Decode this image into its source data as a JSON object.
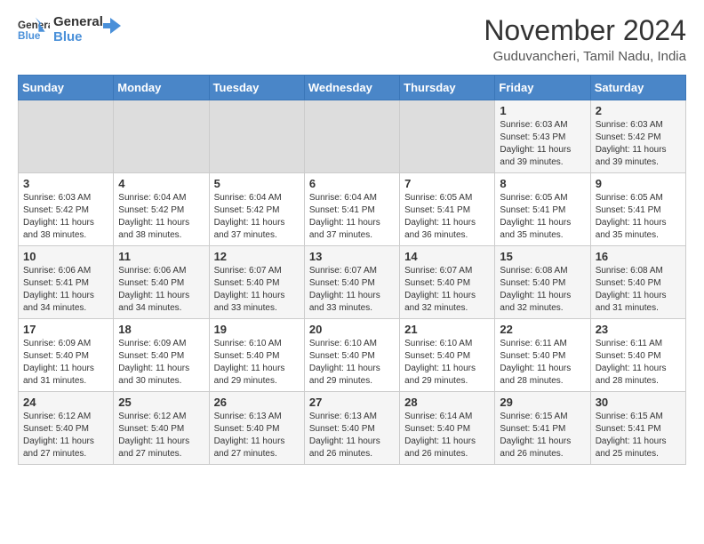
{
  "header": {
    "logo_line1": "General",
    "logo_line2": "Blue",
    "month": "November 2024",
    "location": "Guduvancheri, Tamil Nadu, India"
  },
  "weekdays": [
    "Sunday",
    "Monday",
    "Tuesday",
    "Wednesday",
    "Thursday",
    "Friday",
    "Saturday"
  ],
  "weeks": [
    [
      {
        "day": "",
        "info": ""
      },
      {
        "day": "",
        "info": ""
      },
      {
        "day": "",
        "info": ""
      },
      {
        "day": "",
        "info": ""
      },
      {
        "day": "",
        "info": ""
      },
      {
        "day": "1",
        "info": "Sunrise: 6:03 AM\nSunset: 5:43 PM\nDaylight: 11 hours and 39 minutes."
      },
      {
        "day": "2",
        "info": "Sunrise: 6:03 AM\nSunset: 5:42 PM\nDaylight: 11 hours and 39 minutes."
      }
    ],
    [
      {
        "day": "3",
        "info": "Sunrise: 6:03 AM\nSunset: 5:42 PM\nDaylight: 11 hours and 38 minutes."
      },
      {
        "day": "4",
        "info": "Sunrise: 6:04 AM\nSunset: 5:42 PM\nDaylight: 11 hours and 38 minutes."
      },
      {
        "day": "5",
        "info": "Sunrise: 6:04 AM\nSunset: 5:42 PM\nDaylight: 11 hours and 37 minutes."
      },
      {
        "day": "6",
        "info": "Sunrise: 6:04 AM\nSunset: 5:41 PM\nDaylight: 11 hours and 37 minutes."
      },
      {
        "day": "7",
        "info": "Sunrise: 6:05 AM\nSunset: 5:41 PM\nDaylight: 11 hours and 36 minutes."
      },
      {
        "day": "8",
        "info": "Sunrise: 6:05 AM\nSunset: 5:41 PM\nDaylight: 11 hours and 35 minutes."
      },
      {
        "day": "9",
        "info": "Sunrise: 6:05 AM\nSunset: 5:41 PM\nDaylight: 11 hours and 35 minutes."
      }
    ],
    [
      {
        "day": "10",
        "info": "Sunrise: 6:06 AM\nSunset: 5:41 PM\nDaylight: 11 hours and 34 minutes."
      },
      {
        "day": "11",
        "info": "Sunrise: 6:06 AM\nSunset: 5:40 PM\nDaylight: 11 hours and 34 minutes."
      },
      {
        "day": "12",
        "info": "Sunrise: 6:07 AM\nSunset: 5:40 PM\nDaylight: 11 hours and 33 minutes."
      },
      {
        "day": "13",
        "info": "Sunrise: 6:07 AM\nSunset: 5:40 PM\nDaylight: 11 hours and 33 minutes."
      },
      {
        "day": "14",
        "info": "Sunrise: 6:07 AM\nSunset: 5:40 PM\nDaylight: 11 hours and 32 minutes."
      },
      {
        "day": "15",
        "info": "Sunrise: 6:08 AM\nSunset: 5:40 PM\nDaylight: 11 hours and 32 minutes."
      },
      {
        "day": "16",
        "info": "Sunrise: 6:08 AM\nSunset: 5:40 PM\nDaylight: 11 hours and 31 minutes."
      }
    ],
    [
      {
        "day": "17",
        "info": "Sunrise: 6:09 AM\nSunset: 5:40 PM\nDaylight: 11 hours and 31 minutes."
      },
      {
        "day": "18",
        "info": "Sunrise: 6:09 AM\nSunset: 5:40 PM\nDaylight: 11 hours and 30 minutes."
      },
      {
        "day": "19",
        "info": "Sunrise: 6:10 AM\nSunset: 5:40 PM\nDaylight: 11 hours and 29 minutes."
      },
      {
        "day": "20",
        "info": "Sunrise: 6:10 AM\nSunset: 5:40 PM\nDaylight: 11 hours and 29 minutes."
      },
      {
        "day": "21",
        "info": "Sunrise: 6:10 AM\nSunset: 5:40 PM\nDaylight: 11 hours and 29 minutes."
      },
      {
        "day": "22",
        "info": "Sunrise: 6:11 AM\nSunset: 5:40 PM\nDaylight: 11 hours and 28 minutes."
      },
      {
        "day": "23",
        "info": "Sunrise: 6:11 AM\nSunset: 5:40 PM\nDaylight: 11 hours and 28 minutes."
      }
    ],
    [
      {
        "day": "24",
        "info": "Sunrise: 6:12 AM\nSunset: 5:40 PM\nDaylight: 11 hours and 27 minutes."
      },
      {
        "day": "25",
        "info": "Sunrise: 6:12 AM\nSunset: 5:40 PM\nDaylight: 11 hours and 27 minutes."
      },
      {
        "day": "26",
        "info": "Sunrise: 6:13 AM\nSunset: 5:40 PM\nDaylight: 11 hours and 27 minutes."
      },
      {
        "day": "27",
        "info": "Sunrise: 6:13 AM\nSunset: 5:40 PM\nDaylight: 11 hours and 26 minutes."
      },
      {
        "day": "28",
        "info": "Sunrise: 6:14 AM\nSunset: 5:40 PM\nDaylight: 11 hours and 26 minutes."
      },
      {
        "day": "29",
        "info": "Sunrise: 6:15 AM\nSunset: 5:41 PM\nDaylight: 11 hours and 26 minutes."
      },
      {
        "day": "30",
        "info": "Sunrise: 6:15 AM\nSunset: 5:41 PM\nDaylight: 11 hours and 25 minutes."
      }
    ]
  ]
}
